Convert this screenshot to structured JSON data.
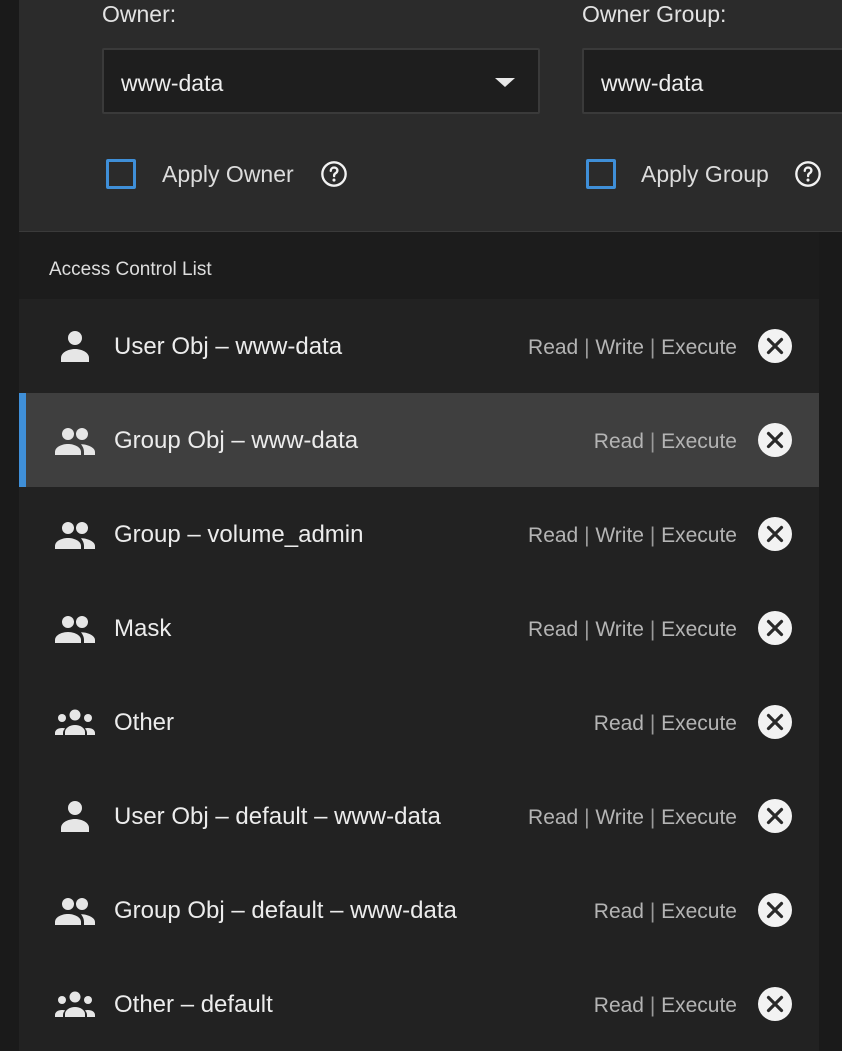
{
  "owner": {
    "label": "Owner:",
    "value": "www-data",
    "apply_label": "Apply Owner"
  },
  "owner_group": {
    "label": "Owner Group:",
    "value": "www-data",
    "apply_label": "Apply Group"
  },
  "acl": {
    "title": "Access Control List",
    "entries": [
      {
        "label": "User Obj – www-data",
        "perms": [
          "Read",
          "Write",
          "Execute"
        ],
        "icon": "person-icon",
        "selected": false
      },
      {
        "label": "Group Obj – www-data",
        "perms": [
          "Read",
          "Execute"
        ],
        "icon": "group-icon",
        "selected": true
      },
      {
        "label": "Group – volume_admin",
        "perms": [
          "Read",
          "Write",
          "Execute"
        ],
        "icon": "group-icon",
        "selected": false
      },
      {
        "label": "Mask",
        "perms": [
          "Read",
          "Write",
          "Execute"
        ],
        "icon": "group-icon",
        "selected": false
      },
      {
        "label": "Other",
        "perms": [
          "Read",
          "Execute"
        ],
        "icon": "groups-icon",
        "selected": false
      },
      {
        "label": "User Obj – default – www-data",
        "perms": [
          "Read",
          "Write",
          "Execute"
        ],
        "icon": "person-icon",
        "selected": false
      },
      {
        "label": "Group Obj – default – www-data",
        "perms": [
          "Read",
          "Execute"
        ],
        "icon": "group-icon",
        "selected": false
      },
      {
        "label": "Other – default",
        "perms": [
          "Read",
          "Execute"
        ],
        "icon": "groups-icon",
        "selected": false
      }
    ]
  },
  "colors": {
    "accent": "#3f8fd8",
    "panel": "#2b2b2b",
    "row": "#222222",
    "row_selected": "#3f3f3f"
  }
}
